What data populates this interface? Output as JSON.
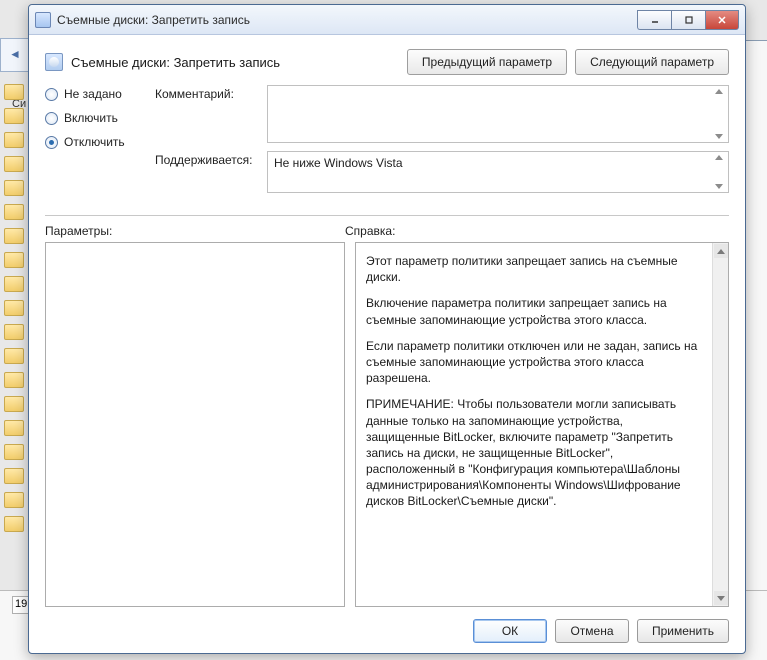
{
  "title": "Съемные диски: Запретить запись",
  "header_title": "Съемные диски: Запретить запись",
  "nav": {
    "prev": "Предыдущий параметр",
    "next": "Следующий параметр"
  },
  "radios": {
    "not_configured": "Не задано",
    "enabled": "Включить",
    "disabled": "Отключить",
    "selected": "disabled"
  },
  "fields": {
    "comment_label": "Комментарий:",
    "comment_value": "",
    "supported_label": "Поддерживается:",
    "supported_value": "Не ниже Windows Vista"
  },
  "panels": {
    "params_label": "Параметры:",
    "help_label": "Справка:"
  },
  "help_paragraphs": [
    "Этот параметр политики запрещает запись на съемные диски.",
    "Включение параметра политики запрещает запись на съемные запоминающие устройства этого класса.",
    "Если параметр политики отключен или не задан, запись на съемные запоминающие устройства этого класса разрешена.",
    "ПРИМЕЧАНИЕ: Чтобы пользователи могли записывать данные только на запоминающие устройства, защищенные BitLocker, включите параметр \"Запретить запись на диски, не защищенные BitLocker\", расположенный в \"Конфигурация компьютера\\Шаблоны администрирования\\Компоненты Windows\\Шифрование дисков BitLocker\\Съемные диски\"."
  ],
  "buttons": {
    "ok": "ОК",
    "cancel": "Отмена",
    "apply": "Применить"
  },
  "background": {
    "status_number": "19",
    "side_label": "Си"
  }
}
